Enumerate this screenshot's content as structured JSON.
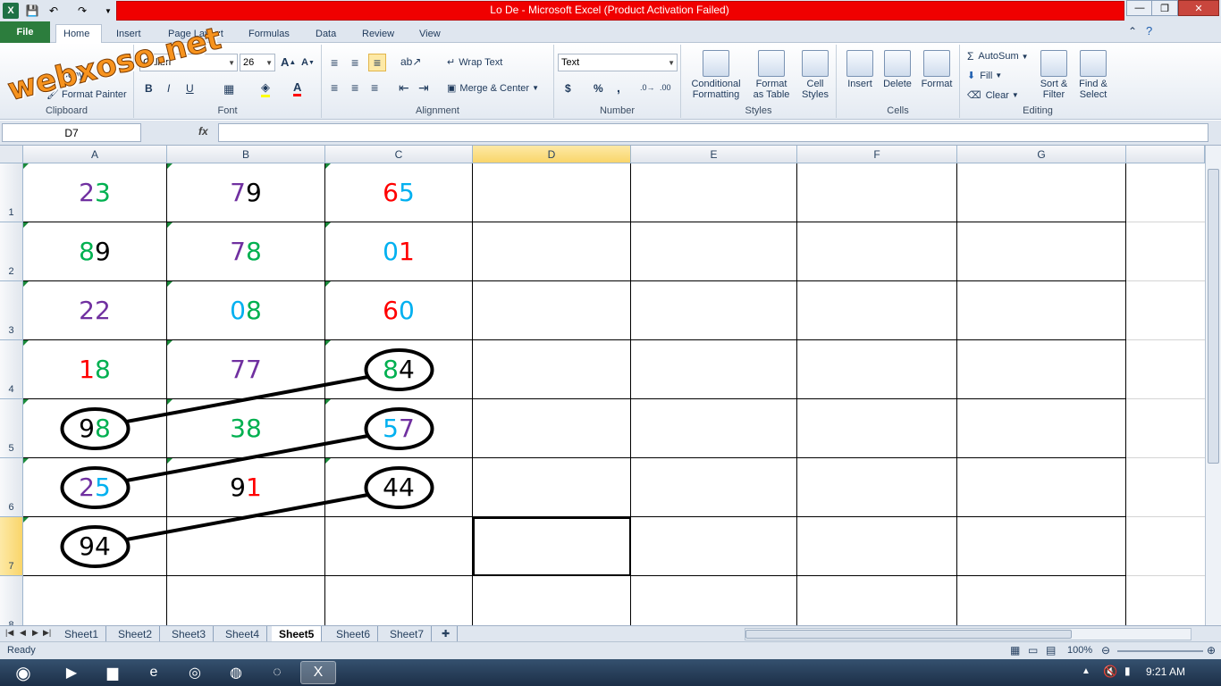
{
  "window": {
    "title": "Lo De  -  Microsoft Excel (Product Activation Failed)",
    "watermark": "webxoso.net",
    "min_label": "—",
    "max_label": "❐",
    "close_label": "✕"
  },
  "qat": {
    "save_icon": "💾",
    "undo_icon": "↶",
    "redo_icon": "↷"
  },
  "tabs": [
    "Home",
    "Insert",
    "Page Layout",
    "Formulas",
    "Data",
    "Review",
    "View"
  ],
  "file_tab": "File",
  "active_tab": "Home",
  "ribbon": {
    "clipboard": {
      "label": "Clipboard",
      "copy": "Copy",
      "format_painter": "Format Painter"
    },
    "font": {
      "label": "Font",
      "name": "Calibri",
      "size": "26",
      "bold": "B",
      "italic": "I",
      "underline": "U"
    },
    "alignment": {
      "label": "Alignment",
      "wrap_text": "Wrap Text",
      "merge_center": "Merge & Center"
    },
    "number": {
      "label": "Number",
      "format": "Text",
      "currency": "$",
      "percent": "%",
      "comma": ","
    },
    "styles": {
      "label": "Styles",
      "conditional": [
        "Conditional",
        "Formatting"
      ],
      "format_table": [
        "Format",
        "as Table"
      ],
      "cell_styles": [
        "Cell",
        "Styles"
      ]
    },
    "cells": {
      "label": "Cells",
      "insert": "Insert",
      "delete": "Delete",
      "format": "Format"
    },
    "editing": {
      "label": "Editing",
      "autosum": "AutoSum",
      "fill": "Fill",
      "clear": "Clear",
      "sort_filter": [
        "Sort &",
        "Filter"
      ],
      "find_select": [
        "Find &",
        "Select"
      ]
    }
  },
  "formula_bar": {
    "name_box": "D7",
    "fx": "fx",
    "value": ""
  },
  "grid": {
    "columns": [
      "A",
      "B",
      "C",
      "D",
      "E",
      "F",
      "G"
    ],
    "rows": [
      "1",
      "2",
      "3",
      "4",
      "5",
      "6",
      "7",
      "8"
    ],
    "selected_column": "D",
    "selected_row": "7",
    "cells": [
      [
        "23",
        "79",
        "65"
      ],
      [
        "89",
        "78",
        "01"
      ],
      [
        "22",
        "08",
        "60"
      ],
      [
        "18",
        "77",
        "84"
      ],
      [
        "98",
        "38",
        "57"
      ],
      [
        "25",
        "91",
        "44"
      ],
      [
        "94",
        "",
        ""
      ]
    ],
    "digit_colors": [
      [
        [
          "#7030a0",
          "#00b050"
        ],
        [
          "#7030a0",
          "#000000"
        ],
        [
          "#ff0000",
          "#00b0f0"
        ]
      ],
      [
        [
          "#00b050",
          "#000000"
        ],
        [
          "#7030a0",
          "#00b050"
        ],
        [
          "#00b0f0",
          "#ff0000"
        ]
      ],
      [
        [
          "#7030a0",
          "#7030a0"
        ],
        [
          "#00b0f0",
          "#00b050"
        ],
        [
          "#ff0000",
          "#00b0f0"
        ]
      ],
      [
        [
          "#ff0000",
          "#00b050"
        ],
        [
          "#7030a0",
          "#7030a0"
        ],
        [
          "#00b050",
          "#000000"
        ]
      ],
      [
        [
          "#000000",
          "#00b050"
        ],
        [
          "#00b050",
          "#00b050"
        ],
        [
          "#00b0f0",
          "#7030a0"
        ]
      ],
      [
        [
          "#7030a0",
          "#00b0f0"
        ],
        [
          "#000000",
          "#ff0000"
        ],
        [
          "#000000",
          "#000000"
        ]
      ],
      [
        [
          "#000000",
          "#000000"
        ],
        [],
        []
      ]
    ],
    "links": [
      {
        "from": "A5",
        "to": "C4"
      },
      {
        "from": "A6",
        "to": "C5"
      },
      {
        "from": "A7",
        "to": "C6"
      }
    ]
  },
  "sheets": [
    "Sheet1",
    "Sheet2",
    "Sheet3",
    "Sheet4",
    "Sheet5",
    "Sheet6",
    "Sheet7"
  ],
  "active_sheet": "Sheet5",
  "status": {
    "text": "Ready",
    "zoom": "100%"
  },
  "taskbar": {
    "time": "9:21 AM",
    "start_icon": "windows-start-icon"
  }
}
